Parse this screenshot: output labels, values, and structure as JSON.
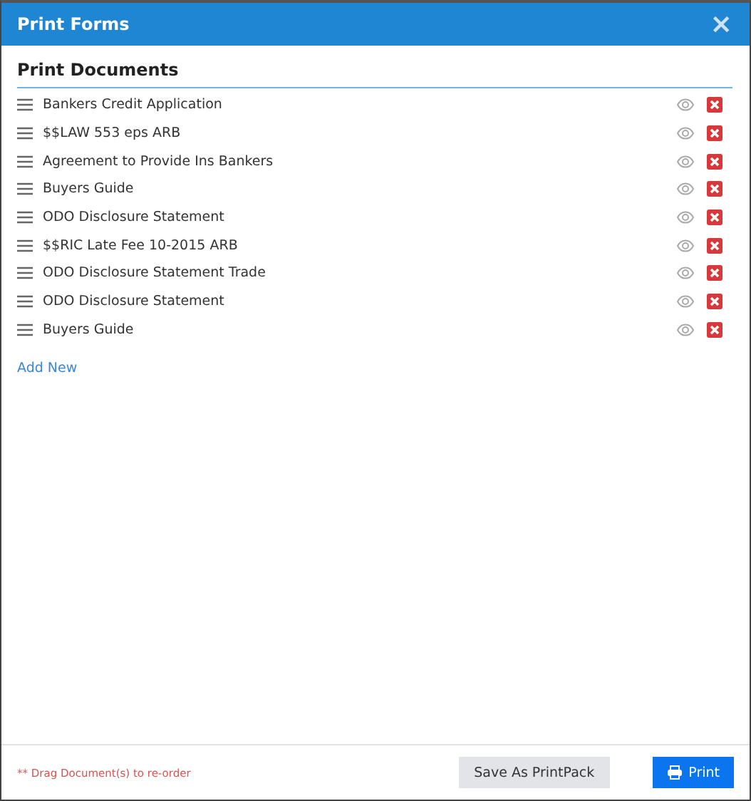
{
  "window": {
    "title": "Print Forms",
    "close": "×"
  },
  "section_title": "Print Documents",
  "documents": [
    {
      "name": "Bankers Credit Application"
    },
    {
      "name": "$$LAW 553 eps ARB"
    },
    {
      "name": "Agreement to Provide Ins Bankers"
    },
    {
      "name": "Buyers Guide"
    },
    {
      "name": "ODO Disclosure Statement"
    },
    {
      "name": "$$RIC Late Fee 10-2015 ARB"
    },
    {
      "name": "ODO Disclosure Statement Trade"
    },
    {
      "name": "ODO Disclosure Statement"
    },
    {
      "name": "Buyers Guide"
    }
  ],
  "add_link": "Add New",
  "footer": {
    "hint": "** Drag Document(s) to re-order",
    "buttons": [
      {
        "label": "Save As PrintPack",
        "kind": "secondary"
      },
      {
        "label": "Print",
        "kind": "primary"
      }
    ]
  }
}
